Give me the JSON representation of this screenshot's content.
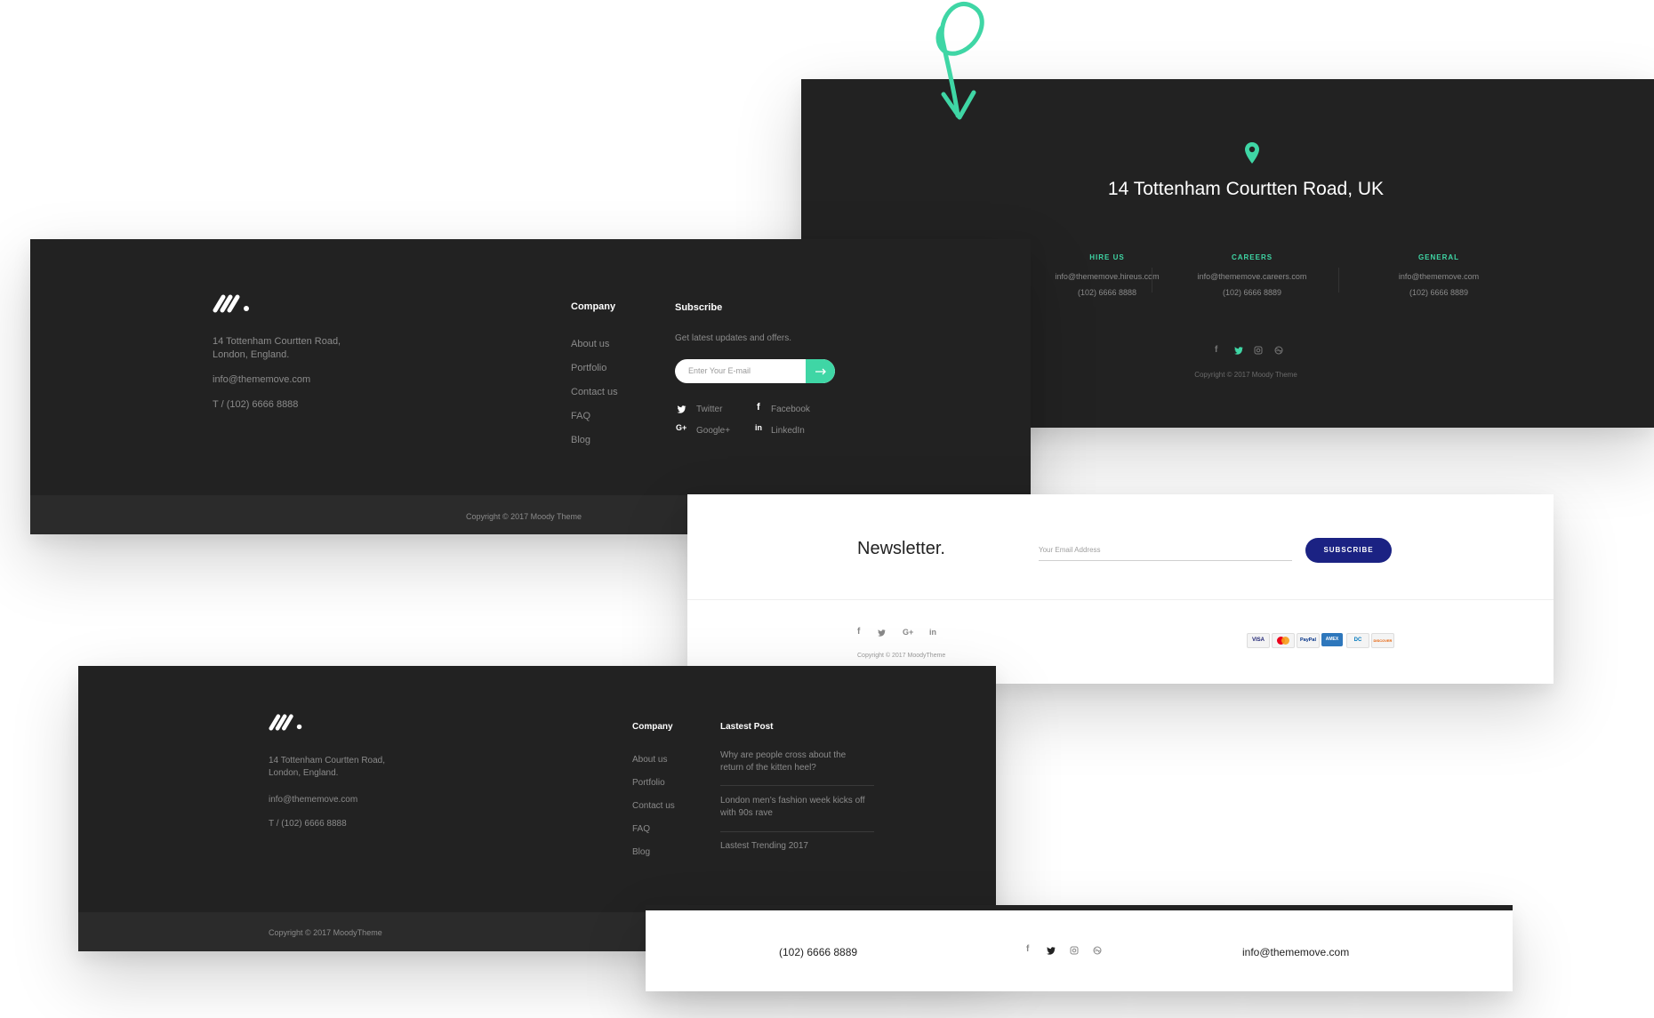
{
  "panel_a": {
    "address": "14 Tottenham Courtten Road, UK",
    "columns": [
      {
        "title": "HIRE US",
        "email": "info@thememove.hireus.com",
        "phone": "(102) 6666 8888"
      },
      {
        "title": "CAREERS",
        "email": "info@thememove.careers.com",
        "phone": "(102) 6666 8889"
      },
      {
        "title": "GENERAL",
        "email": "info@thememove.com",
        "phone": "(102) 6666 8889"
      }
    ],
    "social_icons": [
      "facebook-icon",
      "twitter-icon",
      "instagram-icon",
      "dribbble-icon"
    ],
    "copyright": "Copyright © 2017 Moody Theme"
  },
  "panel_b": {
    "address_line1": "14 Tottenham Courtten Road,",
    "address_line2": "London, England.",
    "email": "info@thememove.com",
    "phone": "T / (102) 6666 8888",
    "company_title": "Company",
    "company_links": [
      "About us",
      "Portfolio",
      "Contact us",
      "FAQ",
      "Blog"
    ],
    "subscribe_title": "Subscribe",
    "subscribe_text": "Get latest updates and offers.",
    "subscribe_placeholder": "Enter Your E-mail",
    "social": {
      "twitter": "Twitter",
      "facebook": "Facebook",
      "googleplus": "Google+",
      "linkedin": "LinkedIn"
    },
    "copyright": "Copyright © 2017 Moody Theme"
  },
  "panel_c": {
    "title": "Newsletter.",
    "email_placeholder": "Your Email Address",
    "subscribe_button": "SUBSCRIBE",
    "copyright": "Copyright © 2017 MoodyTheme",
    "social_icons": [
      "facebook-icon",
      "twitter-icon",
      "google-plus-icon",
      "linkedin-icon"
    ],
    "payment_cards": [
      "VISA",
      "MC",
      "PayPal",
      "AMEX",
      "DC",
      "DISCOVER"
    ]
  },
  "panel_d": {
    "address_line1": "14 Tottenham Courtten Road,",
    "address_line2": "London, England.",
    "email": "info@thememove.com",
    "phone": "T / (102) 6666 8888",
    "company_title": "Company",
    "company_links": [
      "About us",
      "Portfolio",
      "Contact us",
      "FAQ",
      "Blog"
    ],
    "posts_title": "Lastest Post",
    "posts": [
      {
        "line1": "Why are people cross about the",
        "line2": "return of the kitten heel?"
      },
      {
        "line1": "London men’s fashion week kicks off",
        "line2": "with 90s rave"
      },
      {
        "line1": "Lastest Trending 2017",
        "line2": ""
      }
    ],
    "copyright": "Copyright © 2017 MoodyTheme"
  },
  "panel_e": {
    "phone": "(102) 6666 8889",
    "email": "info@thememove.com",
    "social_icons": [
      "facebook-icon",
      "twitter-icon",
      "instagram-icon",
      "dribbble-icon"
    ]
  },
  "colors": {
    "accent": "#3fd6a5",
    "dark_bg": "#222222",
    "navy": "#1b2283"
  }
}
